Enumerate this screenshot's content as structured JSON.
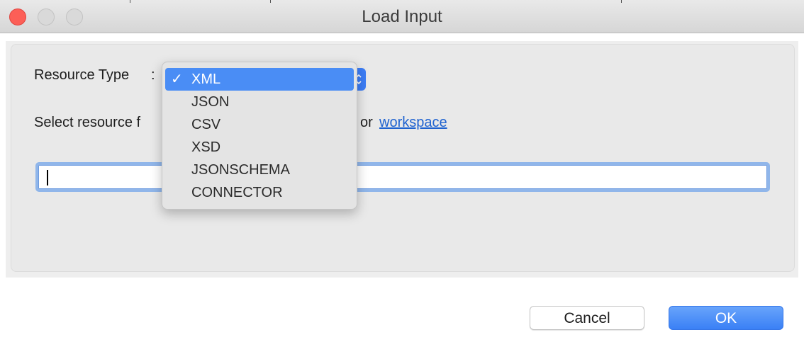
{
  "window": {
    "title": "Load Input"
  },
  "form": {
    "resource_type_label": "Resource Type",
    "colon": ":",
    "select_hint_visible": "Select resource f",
    "or_text": "or",
    "workspace_link": "workspace",
    "path_value": ""
  },
  "dropdown": {
    "items": [
      {
        "label": "XML",
        "selected": true
      },
      {
        "label": "JSON",
        "selected": false
      },
      {
        "label": "CSV",
        "selected": false
      },
      {
        "label": "XSD",
        "selected": false
      },
      {
        "label": "JSONSCHEMA",
        "selected": false
      },
      {
        "label": "CONNECTOR",
        "selected": false
      }
    ],
    "checkmark": "✓"
  },
  "buttons": {
    "cancel": "Cancel",
    "ok": "OK"
  },
  "colors": {
    "accent": "#3c7df6",
    "close": "#fc5f57",
    "link": "#1e62d0"
  },
  "icons": {
    "select_arrow": "updown-chevron-icon"
  }
}
